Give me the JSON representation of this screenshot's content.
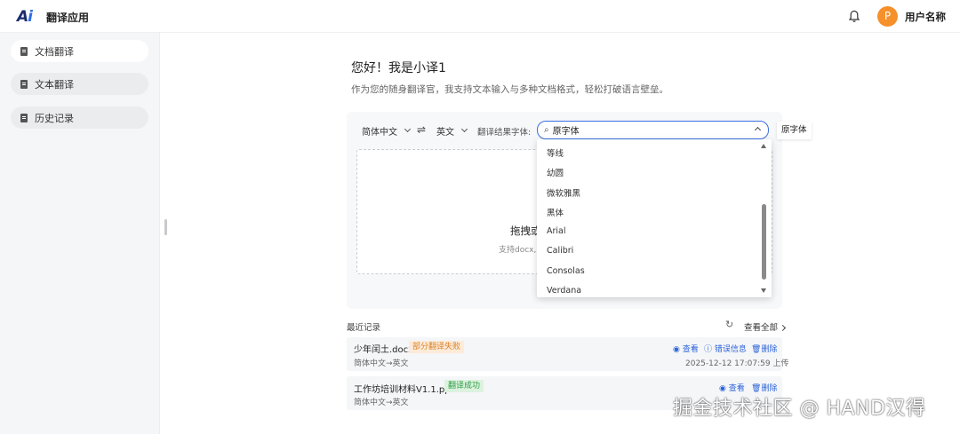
{
  "header": {
    "logo": "Ai",
    "app_title": "翻译应用",
    "avatar_letter": "P",
    "username": "用户名称"
  },
  "sidebar": {
    "items": [
      {
        "label": "文档翻译",
        "active": true
      },
      {
        "label": "文本翻译",
        "active": false
      },
      {
        "label": "历史记录",
        "active": false
      }
    ]
  },
  "main": {
    "greeting": "您好！我是小译1",
    "subtitle": "作为您的随身翻译官，我支持文本输入与多种文档格式，轻松打破语言壁垒。",
    "source_lang": "简体中文",
    "target_lang": "英文",
    "font_label": "翻译结果字体:",
    "font_selected": "原字体",
    "font_preview": "原字体",
    "drop_title": "拖拽或",
    "drop_hint": "支持docx,p"
  },
  "font_dropdown": {
    "options": [
      "等线",
      "幼圆",
      "微软雅黑",
      "黑体",
      "Arial",
      "Calibri",
      "Consolas",
      "Verdana"
    ]
  },
  "records": {
    "title": "最近记录",
    "view_all": "查看全部",
    "items": [
      {
        "filename": "少年闰土.docx",
        "status": "部分翻译失败",
        "langs": "简体中文→英文",
        "actions": [
          "查看",
          "错误信息",
          "删除"
        ],
        "timestamp": "2025-12-12 17:07:59 上传"
      },
      {
        "filename": "工作坊培训材料V1.1.pptx",
        "status": "翻译成功",
        "langs": "简体中文→英文",
        "actions": [
          "查看",
          "删除"
        ]
      }
    ]
  },
  "watermark": "掘金技术社区 @ HAND汉得",
  "colors": {
    "accent": "#3b6fe0",
    "avatar": "#f5902b",
    "fail": "#d9822b",
    "success": "#2e9d44"
  }
}
